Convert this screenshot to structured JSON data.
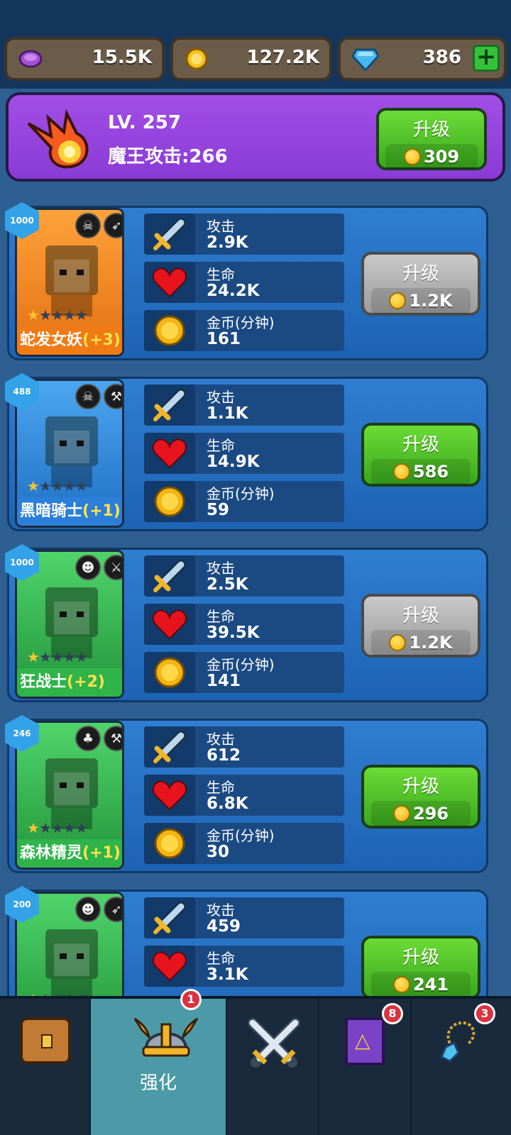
{
  "currencies": [
    {
      "icon": "purple-gem-coin-icon",
      "value": "15.5K"
    },
    {
      "icon": "gold-coin-icon",
      "value": "127.2K"
    },
    {
      "icon": "diamond-icon",
      "value": "386"
    }
  ],
  "boss": {
    "level": "LV. 257",
    "attack": "魔王攻击:266",
    "upgrade_label": "升级",
    "upgrade_cost": "309"
  },
  "stat_labels": {
    "attack": "攻击",
    "life": "生命",
    "gold": "金币(分钟)"
  },
  "heroes": [
    {
      "name": "蛇发女妖",
      "bonus": "(+3)",
      "level": "1000",
      "stars": 1,
      "attack": "2.9K",
      "life": "24.2K",
      "gold": "161",
      "upgrade_label": "升级",
      "cost": "1.2K",
      "enabled": false,
      "theme": "#f08a1c",
      "classes": [
        "skull-icon",
        "bow-icon"
      ]
    },
    {
      "name": "黑暗骑士",
      "bonus": "(+1)",
      "level": "488",
      "stars": 1,
      "attack": "1.1K",
      "life": "14.9K",
      "gold": "59",
      "upgrade_label": "升级",
      "cost": "586",
      "enabled": true,
      "theme": "#2e86de",
      "classes": [
        "skull-icon",
        "hammer-icon"
      ]
    },
    {
      "name": "狂战士",
      "bonus": "(+2)",
      "level": "1000",
      "stars": 1,
      "attack": "2.5K",
      "life": "39.5K",
      "gold": "141",
      "upgrade_label": "升级",
      "cost": "1.2K",
      "enabled": false,
      "theme": "#2fb44a",
      "classes": [
        "orc-icon",
        "sword-icon"
      ]
    },
    {
      "name": "森林精灵",
      "bonus": "(+1)",
      "level": "246",
      "stars": 1,
      "attack": "612",
      "life": "6.8K",
      "gold": "30",
      "upgrade_label": "升级",
      "cost": "296",
      "enabled": true,
      "theme": "#2fb44a",
      "classes": [
        "elf-icon",
        "hammer-icon"
      ]
    },
    {
      "name": "",
      "bonus": "",
      "level": "200",
      "stars": 1,
      "attack": "459",
      "life": "3.1K",
      "gold": "",
      "upgrade_label": "升级",
      "cost": "241",
      "enabled": true,
      "theme": "#2fb44a",
      "classes": [
        "orc-icon",
        "bow-icon"
      ]
    }
  ],
  "nav": {
    "items": [
      {
        "icon": "treasure-chest-icon",
        "label": "",
        "badge": ""
      },
      {
        "icon": "viking-helmet-icon",
        "label": "强化",
        "badge": "1"
      },
      {
        "icon": "crossed-swords-icon",
        "label": "",
        "badge": ""
      },
      {
        "icon": "spell-book-icon",
        "label": "",
        "badge": "8"
      },
      {
        "icon": "amulet-icon",
        "label": "",
        "badge": "3"
      }
    ]
  }
}
